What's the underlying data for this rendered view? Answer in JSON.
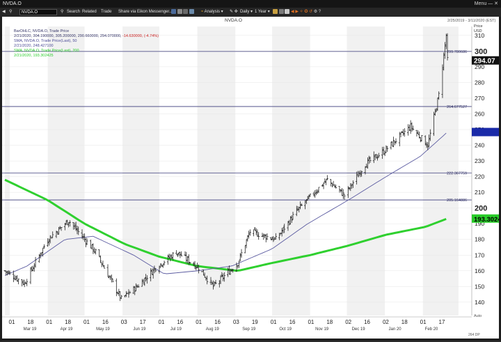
{
  "window": {
    "title": "NVDA.O",
    "menu_label": "Menu"
  },
  "toolbar": {
    "ticker_value": "NVDA.O",
    "search_label": "Search",
    "related_label": "Related",
    "trade_label": "Trade",
    "share_label": "Share via Eikon Messenger...",
    "analysis_label": "Analysis",
    "interval_label": "Daily",
    "period_label": "1 Year"
  },
  "chart_data": {
    "type": "candlestick",
    "title": "NVDA.O",
    "date_range": "2/25/2019 - 3/11/2020 (EST)",
    "price_axis_title": "Price",
    "price_axis_unit": "USD",
    "y_ticks": [
      140,
      150,
      160,
      170,
      180,
      190,
      200,
      210,
      220,
      230,
      240,
      250,
      260,
      270,
      280,
      290,
      300,
      310
    ],
    "ylim": [
      131.5,
      315.7
    ],
    "legend": [
      {
        "name": "BarOHLC, NVDA.O, Trade Price",
        "color": "#333366"
      },
      {
        "name": "2/21/2020, 304.190000, 305.200000, 290.660000, 294.070000, -14.630000, (-4.74%)",
        "color": "#333366",
        "neg_part": "-14.630000, (-4.74%)"
      },
      {
        "name": "SMA, NVDA.O, Trade Price(Last), 50",
        "color": "#4b4b96"
      },
      {
        "name": "2/21/2020, 248.427100",
        "color": "#4b4b96"
      },
      {
        "name": "SMA, NVDA.O, Trade Price(Last), 200",
        "color": "#29cc29"
      },
      {
        "name": "2/21/2020, 193.302425",
        "color": "#29cc29"
      }
    ],
    "x_ticks": [
      "01",
      "18",
      "01",
      "18",
      "01",
      "16",
      "03",
      "17",
      "01",
      "16",
      "01",
      "16",
      "03",
      "19",
      "01",
      "16",
      "01",
      "18",
      "02",
      "16",
      "02",
      "18",
      "01",
      "17"
    ],
    "x_months": [
      "Mar 19",
      "Apr 19",
      "May 19",
      "Jun 19",
      "Jul 19",
      "Aug 19",
      "Sep 19",
      "Oct 19",
      "Nov 19",
      "Dec 19",
      "Jan 20",
      "Feb 20"
    ],
    "x_ticks_right": "Auto",
    "footer_label": "264 DP",
    "hlines": [
      {
        "label": "299.780686",
        "value": 299.78
      },
      {
        "label": "264.677527",
        "value": 264.68
      },
      {
        "label": "222.367759",
        "value": 222.37
      },
      {
        "label": "205.164886",
        "value": 205.16
      }
    ],
    "last_price": {
      "label": "294.07",
      "value": 294.07
    },
    "sma50_last": {
      "label": "248.4271",
      "value": 248.43
    },
    "sma200_last": {
      "label": "193.3024",
      "value": 193.3
    },
    "price_keypoints": [
      {
        "date": "2019-02-25",
        "close": 160
      },
      {
        "date": "2019-03-13",
        "close": 152
      },
      {
        "date": "2019-04-01",
        "close": 180
      },
      {
        "date": "2019-04-18",
        "close": 192
      },
      {
        "date": "2019-05-10",
        "close": 172
      },
      {
        "date": "2019-05-31",
        "close": 142
      },
      {
        "date": "2019-06-13",
        "close": 150
      },
      {
        "date": "2019-06-28",
        "close": 162
      },
      {
        "date": "2019-07-15",
        "close": 172
      },
      {
        "date": "2019-08-02",
        "close": 162
      },
      {
        "date": "2019-08-14",
        "close": 150
      },
      {
        "date": "2019-09-03",
        "close": 165
      },
      {
        "date": "2019-09-13",
        "close": 185
      },
      {
        "date": "2019-10-04",
        "close": 180
      },
      {
        "date": "2019-10-21",
        "close": 198
      },
      {
        "date": "2019-11-07",
        "close": 212
      },
      {
        "date": "2019-11-15",
        "close": 218
      },
      {
        "date": "2019-11-29",
        "close": 208
      },
      {
        "date": "2019-12-16",
        "close": 228
      },
      {
        "date": "2019-12-31",
        "close": 236
      },
      {
        "date": "2020-01-22",
        "close": 252
      },
      {
        "date": "2020-02-05",
        "close": 240
      },
      {
        "date": "2020-02-14",
        "close": 272
      },
      {
        "date": "2020-02-20",
        "close": 310
      },
      {
        "date": "2020-02-21",
        "close": 294
      }
    ],
    "sma50_keypoints": [
      {
        "date": "2019-02-25",
        "value": 157
      },
      {
        "date": "2019-03-15",
        "value": 163
      },
      {
        "date": "2019-04-15",
        "value": 180
      },
      {
        "date": "2019-05-08",
        "value": 182
      },
      {
        "date": "2019-06-10",
        "value": 170
      },
      {
        "date": "2019-07-05",
        "value": 158
      },
      {
        "date": "2019-08-01",
        "value": 160
      },
      {
        "date": "2019-08-29",
        "value": 163
      },
      {
        "date": "2019-10-01",
        "value": 174
      },
      {
        "date": "2019-10-30",
        "value": 190
      },
      {
        "date": "2019-12-02",
        "value": 205
      },
      {
        "date": "2020-01-02",
        "value": 220
      },
      {
        "date": "2020-01-30",
        "value": 233
      },
      {
        "date": "2020-02-21",
        "value": 248.43
      }
    ],
    "sma200_keypoints": [
      {
        "date": "2019-02-25",
        "value": 218
      },
      {
        "date": "2019-04-01",
        "value": 205
      },
      {
        "date": "2019-05-01",
        "value": 190
      },
      {
        "date": "2019-06-03",
        "value": 177
      },
      {
        "date": "2019-07-01",
        "value": 169
      },
      {
        "date": "2019-08-01",
        "value": 163
      },
      {
        "date": "2019-09-03",
        "value": 160
      },
      {
        "date": "2019-10-01",
        "value": 165
      },
      {
        "date": "2019-11-01",
        "value": 170
      },
      {
        "date": "2019-12-02",
        "value": 176
      },
      {
        "date": "2020-01-02",
        "value": 183
      },
      {
        "date": "2020-02-03",
        "value": 188
      },
      {
        "date": "2020-02-21",
        "value": 193.3
      }
    ]
  }
}
